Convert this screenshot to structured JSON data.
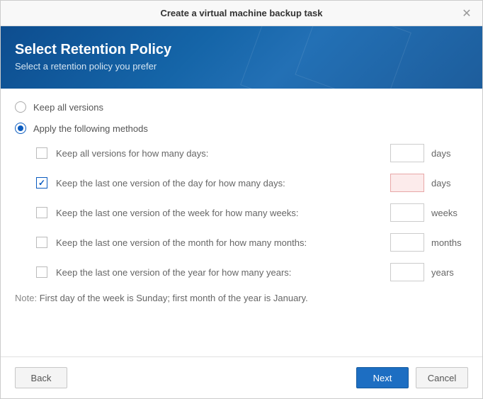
{
  "title": "Create a virtual machine backup task",
  "banner": {
    "heading": "Select Retention Policy",
    "subheading": "Select a retention policy you prefer"
  },
  "radio": {
    "keep_all": "Keep all versions",
    "apply_methods": "Apply the following methods",
    "selected": "apply_methods"
  },
  "methods": [
    {
      "label": "Keep all versions for how many days:",
      "unit": "days",
      "checked": false,
      "value": "",
      "error": false
    },
    {
      "label": "Keep the last one version of the day for how many days:",
      "unit": "days",
      "checked": true,
      "value": "",
      "error": true
    },
    {
      "label": "Keep the last one version of the week for how many weeks:",
      "unit": "weeks",
      "checked": false,
      "value": "",
      "error": false
    },
    {
      "label": "Keep the last one version of the month for how many months:",
      "unit": "months",
      "checked": false,
      "value": "",
      "error": false
    },
    {
      "label": "Keep the last one version of the year for how many years:",
      "unit": "years",
      "checked": false,
      "value": "",
      "error": false
    }
  ],
  "note": {
    "label": "Note: ",
    "text": "First day of the week is Sunday; first month of the year is January."
  },
  "footer": {
    "back": "Back",
    "next": "Next",
    "cancel": "Cancel"
  }
}
